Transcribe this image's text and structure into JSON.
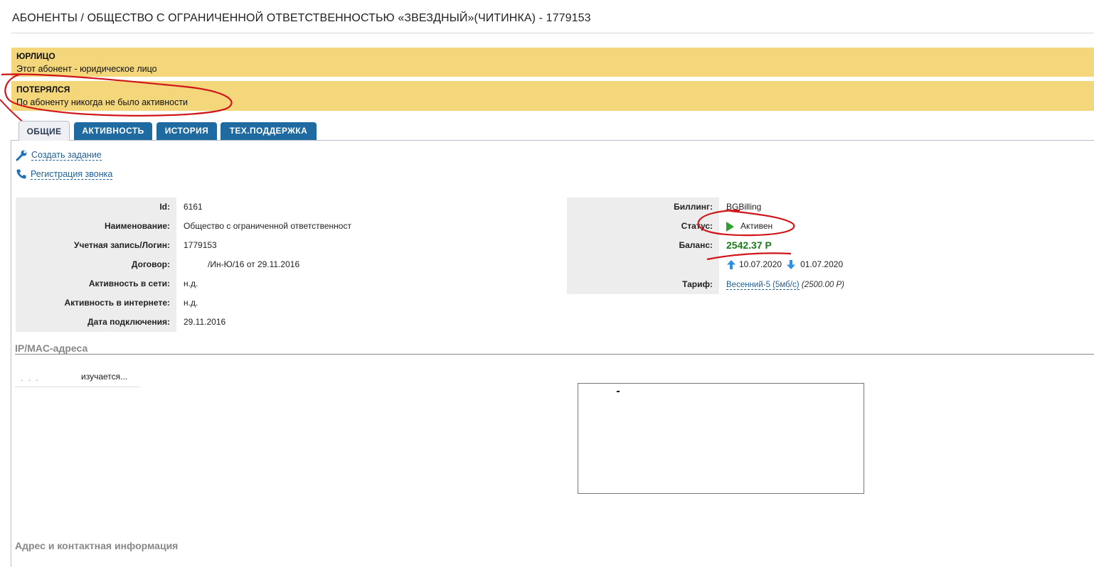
{
  "page": {
    "title": "АБОНЕНТЫ / ОБЩЕСТВО С ОГРАНИЧЕННОЙ ОТВЕТСТВЕННОСТЬЮ «ЗВЕЗДНЫЙ»(ЧИТИНКА) - 1779153"
  },
  "alerts": [
    {
      "heading": "ЮРЛИЦО",
      "text": "Этот абонент - юридическое лицо"
    },
    {
      "heading": "ПОТЕРЯЛСЯ",
      "text": "По абоненту никогда не было активности"
    }
  ],
  "tabs": [
    {
      "label": "ОБЩИЕ",
      "active": true
    },
    {
      "label": "АКТИВНОСТЬ",
      "active": false
    },
    {
      "label": "ИСТОРИЯ",
      "active": false
    },
    {
      "label": "ТЕХ.ПОДДЕРЖКА",
      "active": false
    }
  ],
  "actions": {
    "create_task": "Создать задание",
    "register_call": "Регистрация звонка"
  },
  "info": [
    {
      "label": "Id:",
      "value": "6161"
    },
    {
      "label": "Наименование:",
      "value": "Общество с ограниченной ответственност"
    },
    {
      "label": "Учетная запись/Логин:",
      "value": "1779153"
    },
    {
      "label": "Договор:",
      "value": "/Ин-Ю/16 от 29.11.2016"
    },
    {
      "label": "Активность в сети:",
      "value": "н.д."
    },
    {
      "label": "Активность в интернете:",
      "value": "н.д."
    },
    {
      "label": "Дата подключения:",
      "value": "29.11.2016"
    }
  ],
  "billing": {
    "billing_label": "Биллинг:",
    "billing_value": "BGBilling",
    "status_label": "Статус:",
    "status_value": "Активен",
    "balance_label": "Баланс:",
    "balance_value": "2542.37 Р",
    "date_up": "10.07.2020",
    "date_down": "01.07.2020",
    "tariff_label": "Тариф:",
    "tariff_name": "Весенний-5 (5мб/с)",
    "tariff_price": "(2500.00 Р)"
  },
  "ipmac": {
    "title": "IP/MAC-адреса",
    "row_value": "изучается..."
  },
  "address": {
    "title": "Адрес и контактная информация"
  },
  "colors": {
    "alert_bg": "#f4d67b",
    "tab_bg": "#1e6aa1",
    "link": "#1f5f98",
    "balance": "#1b7b1b",
    "status_icon": "#29a329",
    "annotation": "#d0161a"
  }
}
